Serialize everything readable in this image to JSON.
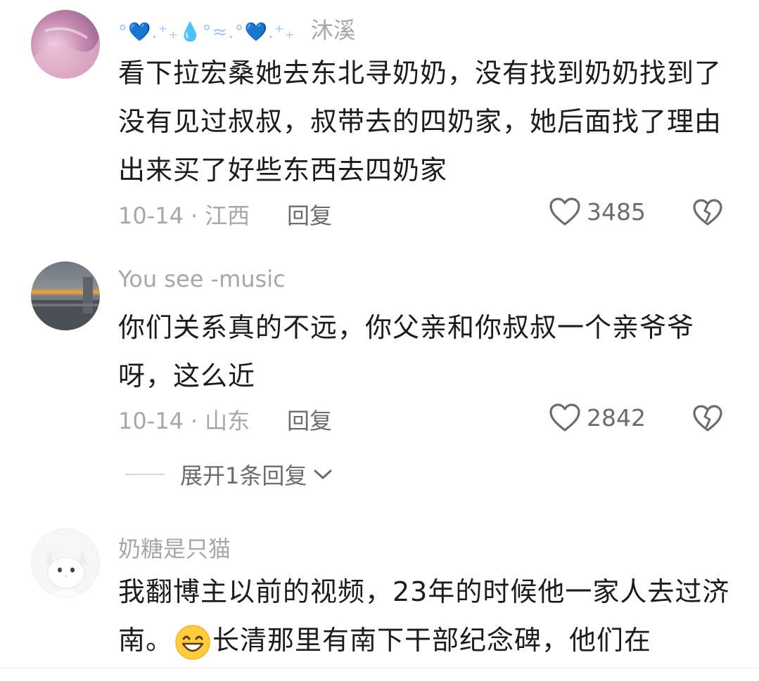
{
  "comments": [
    {
      "username": "沐溪",
      "username_decoration": "°💙.⁺₊💧°≈.°💙.⁺₊",
      "text": "看下拉宏桑她去东北寻奶奶，没有找到奶奶找到了没有见过叔叔，叔带去的四奶家，她后面找了理由出来买了好些东西去四奶家",
      "date": "10-14",
      "location": "江西",
      "reply_label": "回复",
      "likes": "3485",
      "avatar_icon": "pink-abstract-avatar"
    },
    {
      "username": "You see -music",
      "text": "你们关系真的不远，你父亲和你叔叔一个亲爷爷呀，这么近",
      "date": "10-14",
      "location": "山东",
      "reply_label": "回复",
      "likes": "2842",
      "avatar_icon": "sunset-landscape-avatar",
      "expand_label": "展开1条回复"
    },
    {
      "username": "奶糖是只猫",
      "text_part1": "我翻博主以前的视频，23年的时候他一家人去过济南。",
      "text_part2": "长清那里有南下干部纪念碑，他们在",
      "emoji": "grinning-face-emoji",
      "avatar_icon": "white-cat-avatar"
    }
  ],
  "separator": "·",
  "colors": {
    "meta_gray": "#a7a7ab",
    "action_gray": "#6b6b70",
    "text": "#1c1c1e"
  }
}
